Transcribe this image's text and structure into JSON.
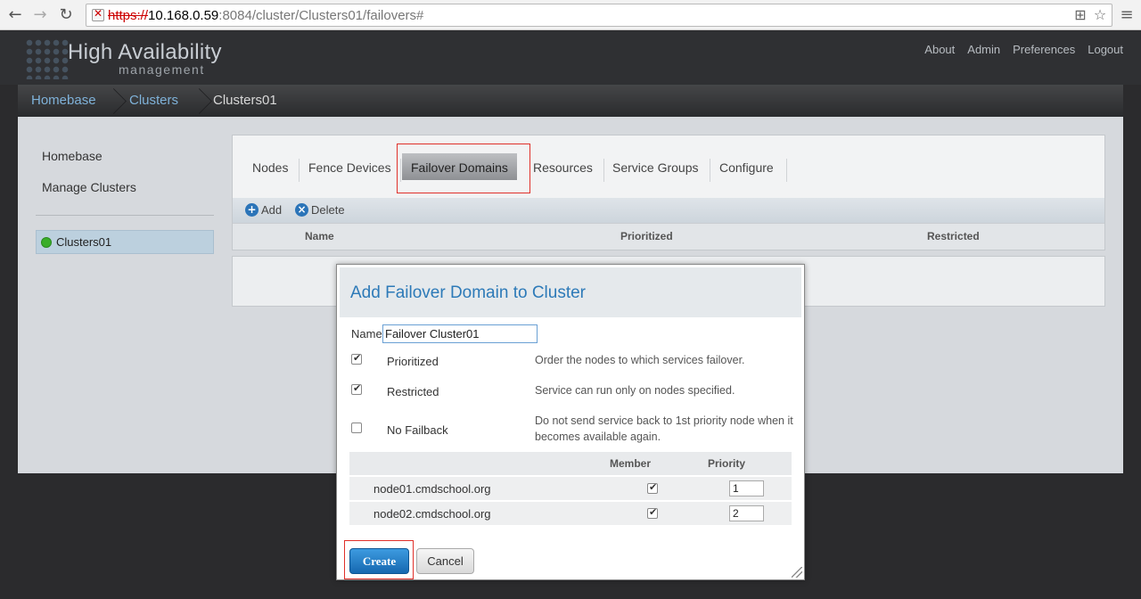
{
  "browser": {
    "url_scheme": "https://",
    "url_host": "10.168.0.59",
    "url_path": ":8084/cluster/Clusters01/failovers#"
  },
  "app": {
    "title": "High Availability",
    "subtitle": "management",
    "top_links": [
      "About",
      "Admin",
      "Preferences",
      "Logout"
    ]
  },
  "breadcrumb": [
    "Homebase",
    "Clusters",
    "Clusters01"
  ],
  "sidebar": {
    "links": [
      "Homebase",
      "Manage Clusters"
    ],
    "cluster": "Clusters01"
  },
  "tabs": [
    "Nodes",
    "Fence Devices",
    "Failover Domains",
    "Resources",
    "Service Groups",
    "Configure"
  ],
  "active_tab": "Failover Domains",
  "toolbar": {
    "add": "Add",
    "delete": "Delete"
  },
  "columns": [
    "Name",
    "Prioritized",
    "Restricted"
  ],
  "modal": {
    "title": "Add Failover Domain to Cluster",
    "name_label": "Name",
    "name_value": "Failover Cluster01",
    "options": [
      {
        "label": "Prioritized",
        "checked": true,
        "desc": "Order the nodes to which services failover."
      },
      {
        "label": "Restricted",
        "checked": true,
        "desc": "Service can run only on nodes specified."
      },
      {
        "label": "No Failback",
        "checked": false,
        "desc": "Do not send service back to 1st priority node when it becomes available again."
      }
    ],
    "table_headers": {
      "member": "Member",
      "priority": "Priority"
    },
    "nodes": [
      {
        "name": "node01.cmdschool.org",
        "member": true,
        "priority": "1"
      },
      {
        "name": "node02.cmdschool.org",
        "member": true,
        "priority": "2"
      }
    ],
    "create_label": "Create",
    "cancel_label": "Cancel"
  },
  "colors": {
    "link_blue": "#2d7ab8",
    "highlight_red": "#e0302a",
    "status_green": "#3aae2a"
  }
}
